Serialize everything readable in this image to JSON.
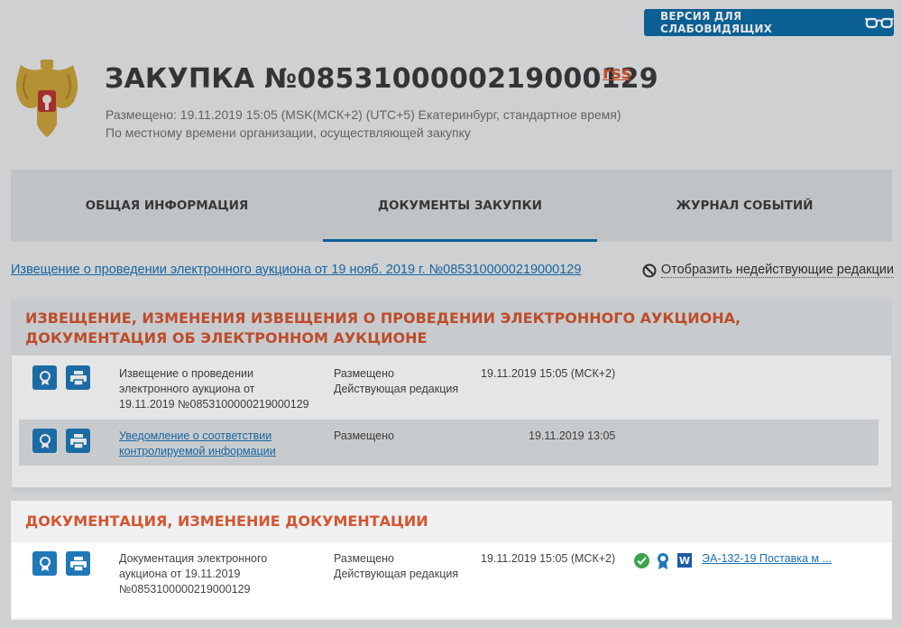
{
  "header": {
    "accessibility_button": "ВЕРСИЯ ДЛЯ СЛАБОВИДЯЩИХ",
    "title": "ЗАКУПКА №0853100000219000129",
    "rss": "rss",
    "posted": "Размещено: 19.11.2019 15:05 (MSK(МСК+2) (UTC+5) Екатеринбург, стандартное время)",
    "posted_note": "По местному времени организации, осуществляющей закупку"
  },
  "tabs": [
    {
      "label": "ОБЩАЯ ИНФОРМАЦИЯ"
    },
    {
      "label": "ДОКУМЕНТЫ ЗАКУПКИ"
    },
    {
      "label": "ЖУРНАЛ СОБЫТИЙ"
    }
  ],
  "notice_link": "Извещение о проведении электронного аукциона от 19 нояб. 2019 г. №0853100000219000129",
  "show_inactive": "Отобразить недействующие редакции",
  "section1": {
    "title": "ИЗВЕЩЕНИЕ, ИЗМЕНЕНИЯ ИЗВЕЩЕНИЯ О ПРОВЕДЕНИИ ЭЛЕКТРОННОГО АУКЦИОНА, ДОКУМЕНТАЦИЯ ОБ ЭЛЕКТРОННОМ АУКЦИОНЕ",
    "rows": [
      {
        "name_lines": [
          "Извещение о проведении",
          "электронного аукциона от",
          "19.11.2019 №0853100000219000129"
        ],
        "status_lines": [
          "Размещено",
          "Действующая редакция"
        ],
        "date": "19.11.2019 15:05 (МСК+2)"
      },
      {
        "name_lines": [
          "Уведомление о соответствии",
          "контролируемой информации"
        ],
        "status_lines": [
          "Размещено"
        ],
        "date": "19.11.2019 13:05"
      }
    ]
  },
  "section2": {
    "title": "ДОКУМЕНТАЦИЯ, ИЗМЕНЕНИЕ ДОКУМЕНТАЦИИ",
    "rows": [
      {
        "name_lines": [
          "Документация электронного",
          "аукциона от 19.11.2019",
          "№0853100000219000129"
        ],
        "status_lines": [
          "Размещено",
          "Действующая редакция"
        ],
        "date": "19.11.2019 15:05 (МСК+2)",
        "file_link": "ЭА-132-19 Поставка м ..."
      }
    ]
  }
}
